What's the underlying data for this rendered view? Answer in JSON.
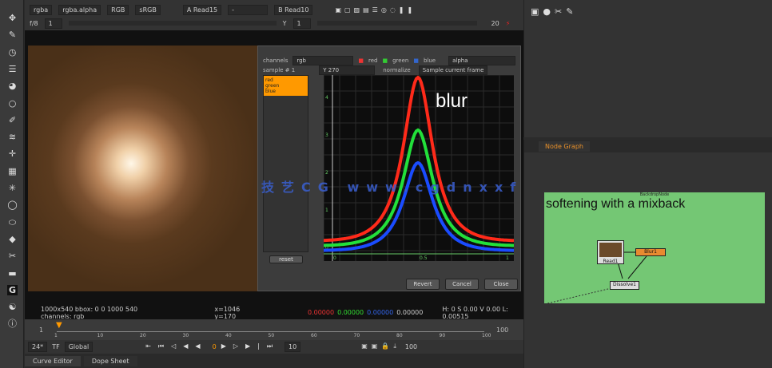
{
  "toolbar": {
    "layer": "rgba",
    "channel": "rgba.alpha",
    "rgb": "RGB",
    "colorspace": "sRGB",
    "input_a": "A Read15",
    "input_b": "B Read10",
    "frame_label": "f/8",
    "frame_value": "1",
    "y_label": "Y",
    "y_value": "1",
    "zoom": "20"
  },
  "left_tools": [
    "move",
    "paint",
    "clock",
    "menu",
    "shapes",
    "circle",
    "curve",
    "layers",
    "transform",
    "cube",
    "particles",
    "ellipse",
    "ellipse2",
    "eraser",
    "keyer",
    "panel",
    "gizmo",
    "text",
    "info"
  ],
  "dialog": {
    "channels_label": "channels",
    "channels_value": "rgb",
    "red": "red",
    "green": "green",
    "blue": "blue",
    "alpha": "alpha",
    "sample_label": "sample # 1",
    "y_value": "Y 270",
    "normalize": "normalize",
    "sample_button": "Sample current frame",
    "list": [
      "red",
      "green",
      "blue"
    ],
    "reset": "reset",
    "buttons": [
      "Revert",
      "Cancel",
      "Close"
    ],
    "axis_x": [
      "0",
      "0.5",
      "1"
    ],
    "axis_y": [
      "4",
      "3",
      "2",
      "1",
      "0"
    ],
    "overlay": "blur",
    "colors": {
      "red": "#ff2a1a",
      "green": "#22e03a",
      "blue": "#1a4cff"
    }
  },
  "watermark": "技艺CG www.cgdnxxfb.cn",
  "info_bar": {
    "format": "1000x540 bbox: 0 0 1000 540 channels: rgb",
    "coords": "x=1046 y=170",
    "r": "0.00000",
    "g": "0.00000",
    "b": "0.00000",
    "a": "0.00000",
    "hsv": "H: 0 S 0.00 V 0.00  L: 0.00515"
  },
  "timeline": {
    "start": "1",
    "ticks": [
      "1",
      "10",
      "20",
      "30",
      "40",
      "50",
      "60",
      "70",
      "80",
      "90",
      "100"
    ],
    "end": "100",
    "fps": "24*",
    "tf": "TF",
    "global": "Global",
    "current_frame": "0",
    "step": "10",
    "out": "100"
  },
  "bottom_tabs": [
    "Curve Editor",
    "Dope Sheet"
  ],
  "node_graph": {
    "tab": "Node Graph",
    "backdrop_label": "BackdropNode",
    "backdrop_title": "softening with a mixback",
    "nodes": [
      "Read1",
      "Blur1",
      "Dissolve1"
    ]
  }
}
